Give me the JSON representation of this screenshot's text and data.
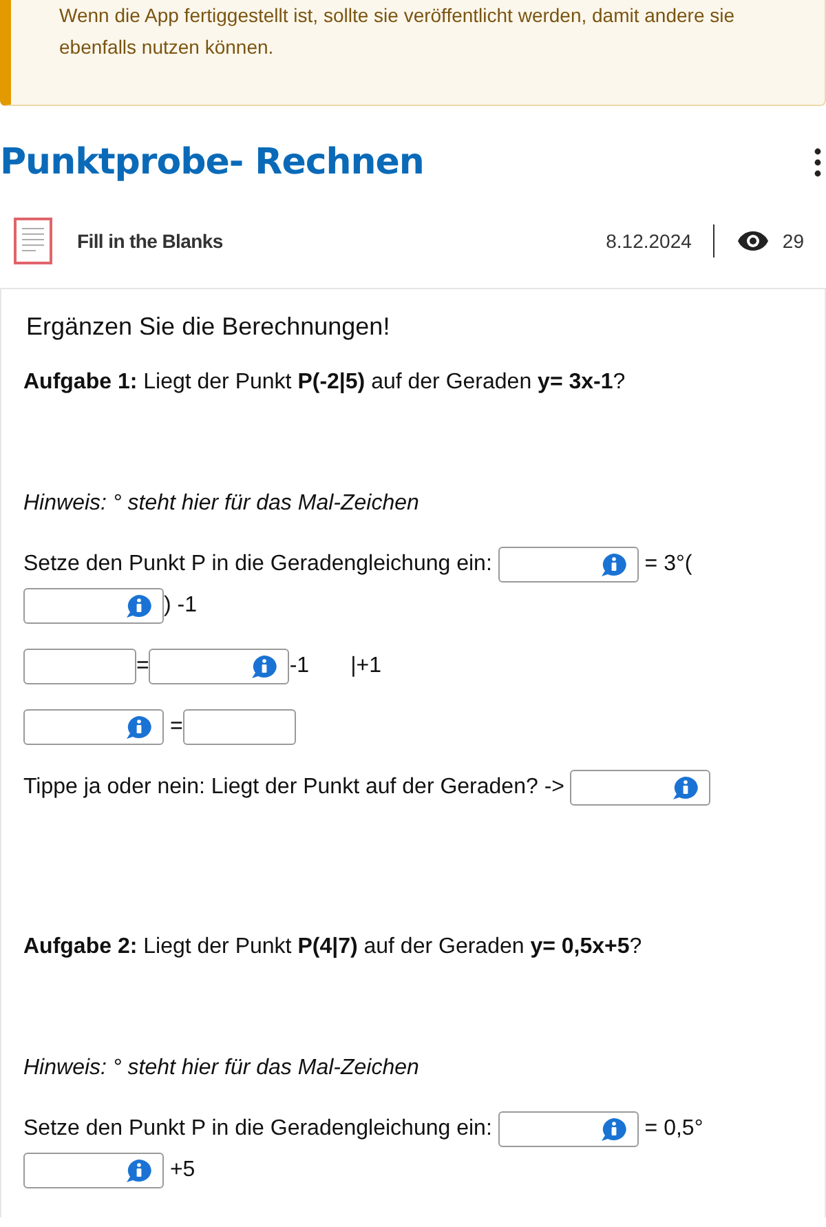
{
  "notice": {
    "text": "Wenn die App fertiggestellt ist, sollte sie veröffentlicht werden, damit andere sie ebenfalls nutzen können."
  },
  "title": "Punktprobe- Rechnen",
  "meta": {
    "type": "Fill in the Blanks",
    "date": "8.12.2024",
    "views": "29"
  },
  "blocks": [
    {
      "kind": "heading",
      "text": "Ergänzen Sie die Berechnungen!"
    },
    {
      "kind": "task",
      "text": "**Aufgabe 1:** Liegt der Punkt **P(-2|5)**  auf der Geraden **y= 3x-1**?"
    },
    {
      "kind": "hint",
      "text": "Hinweis: ° steht hier für das Mal-Zeichen"
    },
    {
      "kind": "line",
      "parts": [
        {
          "kind": "text",
          "text": "Setze den Punkt P in die Geradengleichung ein: "
        },
        {
          "kind": "blank",
          "hint": true
        },
        {
          "kind": "text",
          "text": " = 3°("
        },
        {
          "kind": "blank",
          "hint": true
        },
        {
          "kind": "text",
          "text": ") -1"
        }
      ]
    },
    {
      "kind": "line",
      "parts": [
        {
          "kind": "blank",
          "hint": false
        },
        {
          "kind": "text",
          "text": "="
        },
        {
          "kind": "blank",
          "hint": true
        },
        {
          "kind": "text",
          "text": "-1"
        },
        {
          "kind": "note",
          "text": "|+1"
        }
      ]
    },
    {
      "kind": "line",
      "parts": [
        {
          "kind": "blank",
          "hint": true
        },
        {
          "kind": "text",
          "text": " ="
        },
        {
          "kind": "blank",
          "hint": false
        }
      ]
    },
    {
      "kind": "line",
      "parts": [
        {
          "kind": "text",
          "text": "Tippe ja oder nein: Liegt der Punkt auf der Geraden? -> "
        },
        {
          "kind": "blank",
          "hint": true
        }
      ]
    },
    {
      "kind": "task",
      "text": "**Aufgabe 2:** Liegt der Punkt **P(4|7)**  auf der Geraden **y= 0,5x+5**?"
    },
    {
      "kind": "hint",
      "text": "Hinweis: ° steht hier für das Mal-Zeichen"
    },
    {
      "kind": "line",
      "parts": [
        {
          "kind": "text",
          "text": "Setze den Punkt P in die Geradengleichung ein: "
        },
        {
          "kind": "blank",
          "hint": true
        },
        {
          "kind": "text",
          "text": " = 0,5°"
        },
        {
          "kind": "blank",
          "hint": true
        },
        {
          "kind": "text",
          "text": " +5"
        }
      ]
    }
  ]
}
